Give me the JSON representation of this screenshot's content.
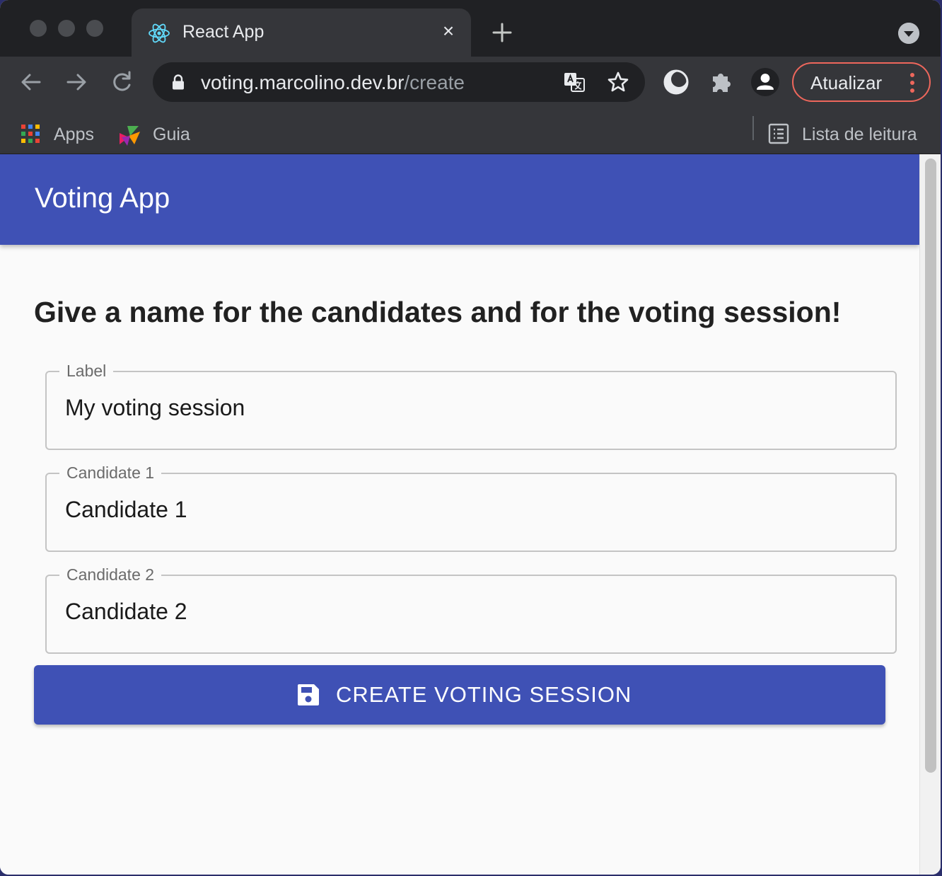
{
  "browser": {
    "tab": {
      "title": "React App",
      "favicon": "react-logo-icon"
    },
    "address": {
      "host": "voting.marcolino.dev.br",
      "path": "/create"
    },
    "update_button": "Atualizar",
    "bookmarks": {
      "apps": "Apps",
      "guia": "Guia",
      "reading_list": "Lista de leitura"
    }
  },
  "app": {
    "title": "Voting App",
    "heading": "Give a name for the candidates and for the voting session!",
    "fields": [
      {
        "label": "Label",
        "value": "My voting session"
      },
      {
        "label": "Candidate 1",
        "value": "Candidate 1"
      },
      {
        "label": "Candidate 2",
        "value": "Candidate 2"
      }
    ],
    "submit_label": "CREATE VOTING SESSION",
    "submit_icon": "save-icon"
  },
  "colors": {
    "primary": "#3f51b5",
    "update_border": "#ee675c"
  }
}
